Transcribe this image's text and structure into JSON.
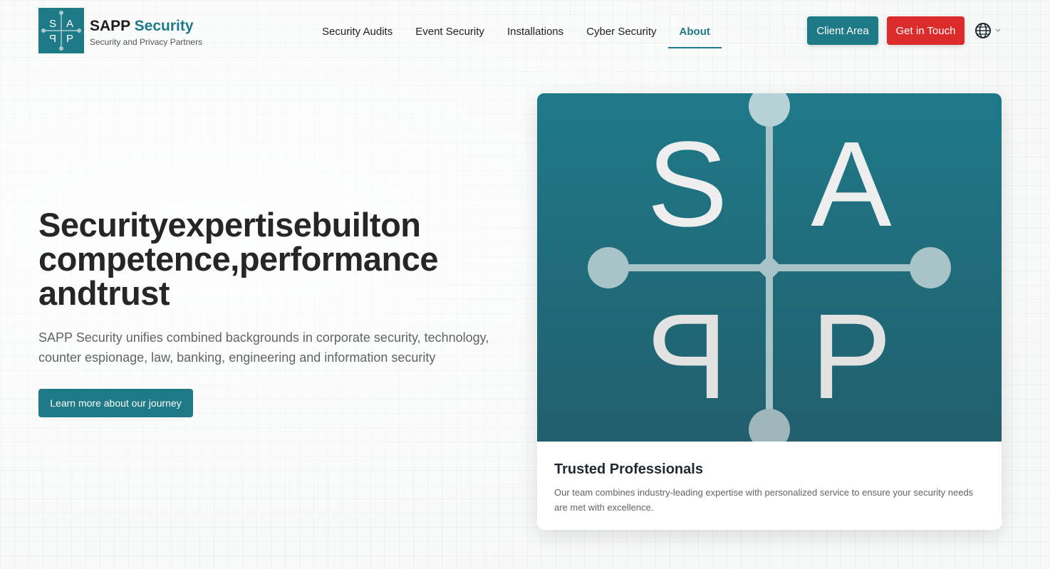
{
  "brand": {
    "name_part1": "SAPP",
    "name_part2": "Security",
    "tagline": "Security and Privacy Partners",
    "logo_letters": [
      "S",
      "A",
      "P",
      "P"
    ]
  },
  "nav": {
    "items": [
      {
        "label": "Security Audits",
        "active": false
      },
      {
        "label": "Event Security",
        "active": false
      },
      {
        "label": "Installations",
        "active": false
      },
      {
        "label": "Cyber Security",
        "active": false
      },
      {
        "label": "About",
        "active": true
      }
    ]
  },
  "header_actions": {
    "client_area": "Client Area",
    "get_in_touch": "Get in Touch",
    "language_icon": "globe-icon"
  },
  "hero": {
    "title_line1": "Securityexpertisebuilton",
    "title_line2": "competence,performance",
    "title_line3": "andtrust",
    "description": "SAPP Security unifies combined backgrounds in corporate security, technology, counter espionage, law, banking, engineering and information security",
    "cta": "Learn more about our journey"
  },
  "card": {
    "image_letters": [
      "S",
      "A",
      "P",
      "P"
    ],
    "title": "Trusted Professionals",
    "text": "Our team combines industry-leading expertise with personalized service to ensure your security needs are met with excellence."
  },
  "colors": {
    "brand_teal": "#1f7a88",
    "cta_red": "#dc2b2b"
  }
}
